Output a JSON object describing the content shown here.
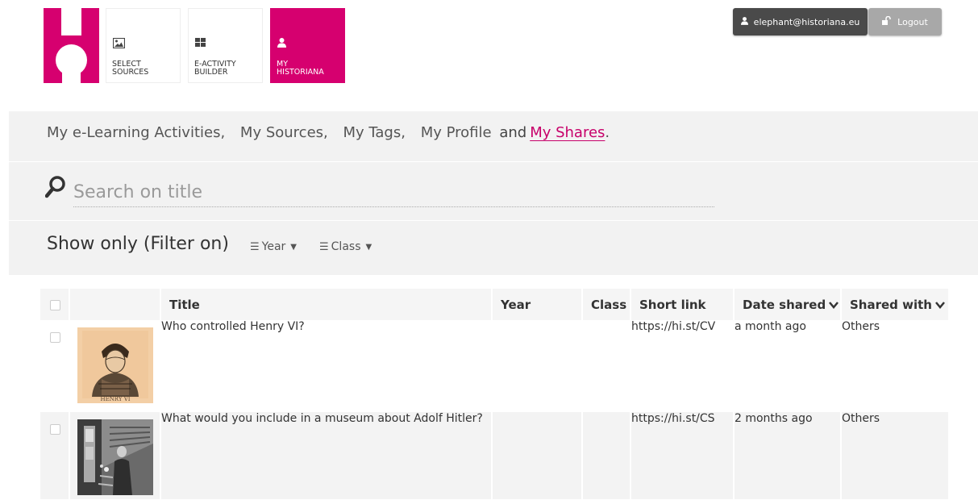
{
  "header": {
    "nav": [
      {
        "label": "SELECT\nSOURCES",
        "icon": "image-icon"
      },
      {
        "label": "E-ACTIVITY\nBUILDER",
        "icon": "grid-icon"
      },
      {
        "label": "MY\nHISTORIANA",
        "icon": "user-icon"
      }
    ],
    "user_email": "elephant@historiana.eu",
    "logout_label": "Logout"
  },
  "sections": {
    "links": [
      "My e-Learning Activities,",
      "My Sources,",
      "My Tags,",
      "My Profile"
    ],
    "and_word": "and",
    "active_link": "My Shares",
    "period": "."
  },
  "search": {
    "placeholder": "Search on title"
  },
  "filter": {
    "title": "Show only (Filter on)",
    "year_label": "Year",
    "class_label": "Class"
  },
  "table": {
    "headers": {
      "title": "Title",
      "year": "Year",
      "class": "Class",
      "short_link": "Short link",
      "date_shared": "Date shared",
      "shared_with": "Shared with"
    },
    "rows": [
      {
        "title": "Who controlled Henry VI?",
        "year": "",
        "class": "",
        "short_link": "https://hi.st/CV",
        "date_shared": "a month ago",
        "shared_with": "Others",
        "thumb_caption": "HENRY VI"
      },
      {
        "title": "What would you include in a museum about Adolf Hitler?",
        "year": "",
        "class": "",
        "short_link": "https://hi.st/CS",
        "date_shared": "2 months ago",
        "shared_with": "Others"
      }
    ]
  },
  "colors": {
    "brand": "#d6006f",
    "user_button": "#4a4a4a",
    "logout_button": "#a8a8a8",
    "panel": "#f2f2f2"
  }
}
